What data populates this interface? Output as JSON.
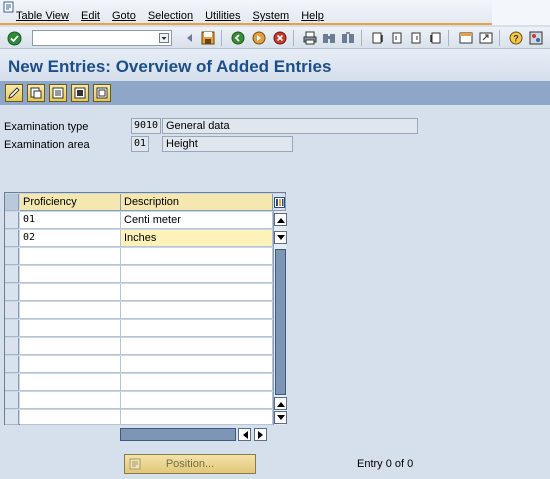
{
  "menubar": {
    "items": [
      "Table View",
      "Edit",
      "Goto",
      "Selection",
      "Utilities",
      "System",
      "Help"
    ]
  },
  "toolbar": {
    "icons": [
      "enter-icon",
      "command-field-dropdown-icon",
      "back-arrow-icon",
      "save-icon",
      "back-icon",
      "exit-icon",
      "cancel-icon",
      "print-icon",
      "find-icon",
      "find-next-icon",
      "first-page-icon",
      "previous-page-icon",
      "next-page-icon",
      "last-page-icon",
      "create-session-icon",
      "shortcut-icon",
      "help-icon",
      "layout-icon"
    ]
  },
  "title": "New Entries: Overview of Added Entries",
  "app_toolbar": {
    "icons": [
      "change-display-icon",
      "copy-as-icon",
      "delete-icon",
      "select-all-icon",
      "deselect-all-icon"
    ]
  },
  "header": {
    "exam_type_label": "Examination type",
    "exam_type_code": "9010",
    "exam_type_text": "General data",
    "exam_area_label": "Examination area",
    "exam_area_code": "01",
    "exam_area_text": "Height"
  },
  "table": {
    "columns": [
      "Proficiency",
      "Description"
    ],
    "rows": [
      {
        "proficiency": "01",
        "description": "Centi meter"
      },
      {
        "proficiency": "02",
        "description": "Inches"
      }
    ],
    "empty_rows": 10
  },
  "footer": {
    "position_label": "Position...",
    "entry_status": "Entry 0 of 0"
  },
  "colors": {
    "title": "#1c4e8a",
    "app_toolbar": "#8ea7c9",
    "table_header": "#f4e7b0",
    "focused_cell": "#fdf3b8",
    "menubar_accent": "#e8a040"
  }
}
